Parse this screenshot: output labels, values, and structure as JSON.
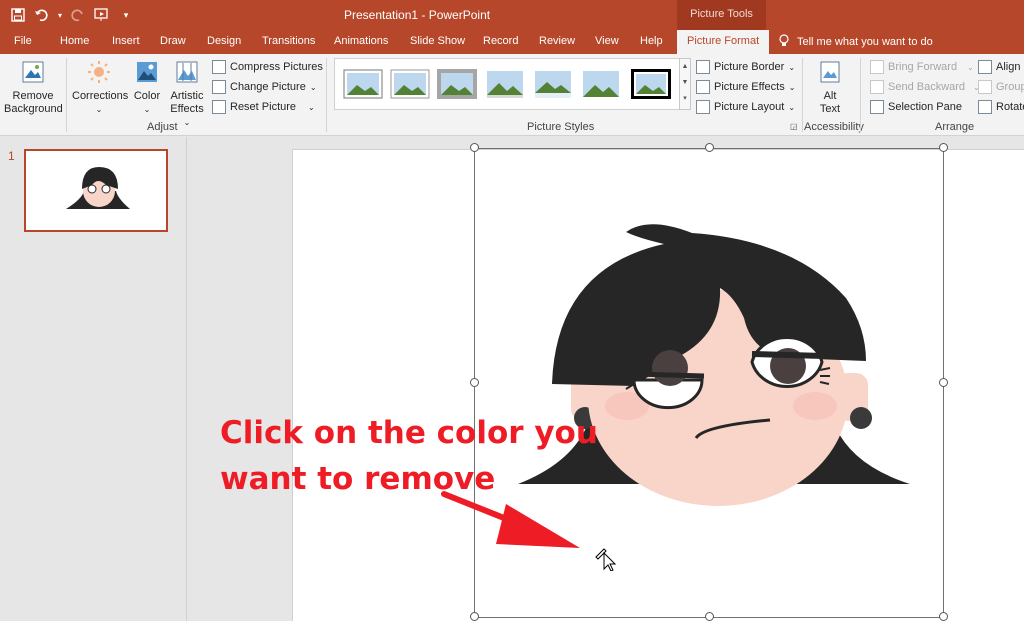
{
  "titlebar": {
    "title": "Presentation1  -  PowerPoint",
    "context_header": "Picture Tools"
  },
  "tabs": [
    {
      "label": "File"
    },
    {
      "label": "Home"
    },
    {
      "label": "Insert"
    },
    {
      "label": "Draw"
    },
    {
      "label": "Design"
    },
    {
      "label": "Transitions"
    },
    {
      "label": "Animations"
    },
    {
      "label": "Slide Show"
    },
    {
      "label": "Record"
    },
    {
      "label": "Review"
    },
    {
      "label": "View"
    },
    {
      "label": "Help"
    },
    {
      "label": "Picture Format"
    }
  ],
  "tell_me": "Tell me what you want to do",
  "ribbon": {
    "remove_bg_1": "Remove",
    "remove_bg_2": "Background",
    "corrections": "Corrections",
    "color": "Color",
    "artistic_1": "Artistic",
    "artistic_2": "Effects",
    "compress": "Compress Pictures",
    "change_pic": "Change Picture",
    "reset_pic": "Reset Picture",
    "group_adjust": "Adjust",
    "group_styles": "Picture Styles",
    "border": "Picture Border",
    "effects": "Picture Effects",
    "layout": "Picture Layout",
    "alt_1": "Alt",
    "alt_2": "Text",
    "group_access": "Accessibility",
    "bring_fwd": "Bring Forward",
    "send_back": "Send Backward",
    "sel_pane": "Selection Pane",
    "align": "Align",
    "group": "Group",
    "rotate": "Rotate",
    "group_arrange": "Arrange"
  },
  "slides_pane": {
    "number": "1"
  },
  "callout": {
    "line1": "Click on the color you",
    "line2": "want to remove"
  },
  "colors": {
    "accent": "#b7472a",
    "callout_red": "#ee1c25",
    "hair": "#262626",
    "skin": "#f9d5c9"
  }
}
